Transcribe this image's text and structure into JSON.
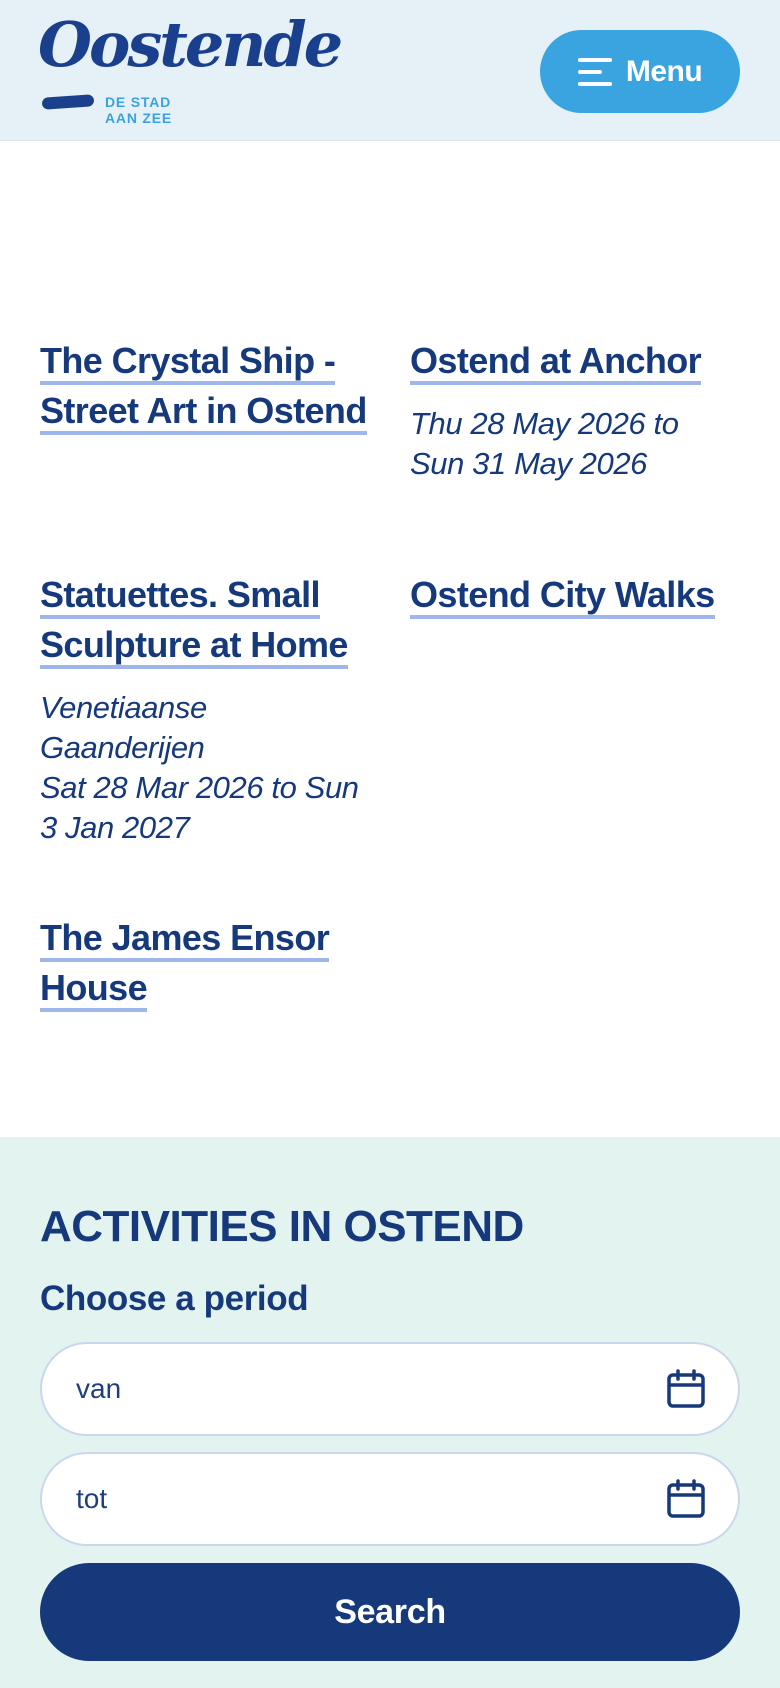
{
  "header": {
    "logo": {
      "wordmark": "Oostende",
      "tagline_line1": "DE STAD",
      "tagline_line2": "AAN ZEE"
    },
    "menu_label": "Menu",
    "menu_icon": "hamburger-icon"
  },
  "events": [
    {
      "title": "The Crystal Ship - Street Art in Ostend",
      "meta": []
    },
    {
      "title": "Ostend at Anchor",
      "meta": [
        "Thu 28 May 2026 to Sun 31 May 2026"
      ]
    },
    {
      "title": "Statuettes. Small Sculpture at Home",
      "meta": [
        "Venetiaanse Gaanderijen",
        "Sat 28 Mar 2026 to Sun 3 Jan 2027"
      ]
    },
    {
      "title": "Ostend City Walks",
      "meta": []
    },
    {
      "title": "The James Ensor House",
      "meta": []
    }
  ],
  "activities": {
    "heading": "ACTIVITIES IN OSTEND",
    "period_label": "Choose a period",
    "from_placeholder": "van",
    "to_placeholder": "tot",
    "calendar_icon": "calendar-icon",
    "search_label": "Search"
  },
  "colors": {
    "brand_navy": "#16397c",
    "brand_sky": "#3aa4e1",
    "header_bg": "#e6f0f7",
    "section_bg": "#e3f3f0",
    "underline": "#9fb6ea"
  }
}
